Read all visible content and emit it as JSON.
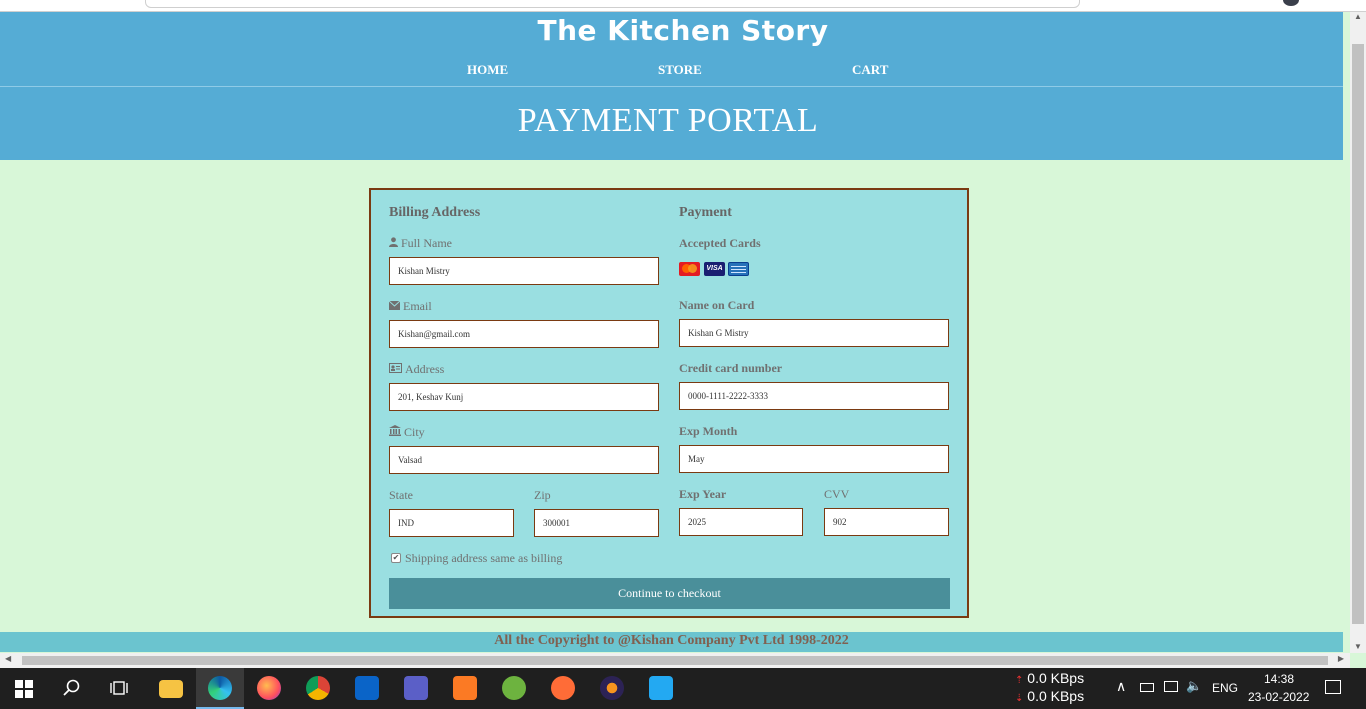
{
  "site": {
    "title": "The Kitchen Story",
    "nav": [
      "HOME",
      "STORE",
      "CART"
    ],
    "heading": "PAYMENT PORTAL"
  },
  "billing": {
    "title": "Billing Address",
    "full_name_label": "Full Name",
    "full_name_value": "Kishan Mistry",
    "email_label": "Email",
    "email_value": "Kishan@gmail.com",
    "address_label": "Address",
    "address_value": "201, Keshav Kunj",
    "city_label": "City",
    "city_value": "Valsad",
    "state_label": "State",
    "state_value": "IND",
    "zip_label": "Zip",
    "zip_value": "300001",
    "shipping_checkbox_label": "Shipping address same as billing",
    "shipping_checked": true
  },
  "payment": {
    "title": "Payment",
    "accepted_cards_label": "Accepted Cards",
    "cards": [
      "mastercard-icon",
      "visa-icon",
      "amex-icon"
    ],
    "visa_text": "VISA",
    "name_on_card_label": "Name on Card",
    "name_on_card_value": "Kishan G Mistry",
    "card_number_label": "Credit card number",
    "card_number_value": "0000-1111-2222-3333",
    "exp_month_label": "Exp Month",
    "exp_month_value": "May",
    "exp_year_label": "Exp Year",
    "exp_year_value": "2025",
    "cvv_label": "CVV",
    "cvv_value": "902"
  },
  "submit_label": "Continue to checkout",
  "footer": "All the Copyright to @Kishan Company Pvt Ltd 1998-2022",
  "taskbar": {
    "net_up": "0.0 KBps",
    "net_down": "0.0 KBps",
    "lang": "ENG",
    "time": "14:38",
    "date": "23-02-2022"
  },
  "colors": {
    "header": "#55acd5",
    "page_bg": "#d8f7d8",
    "card_bg": "#9adfe1",
    "card_border": "#7a3a12",
    "button": "#4a8f9a",
    "footer": "#6bc4cf"
  }
}
